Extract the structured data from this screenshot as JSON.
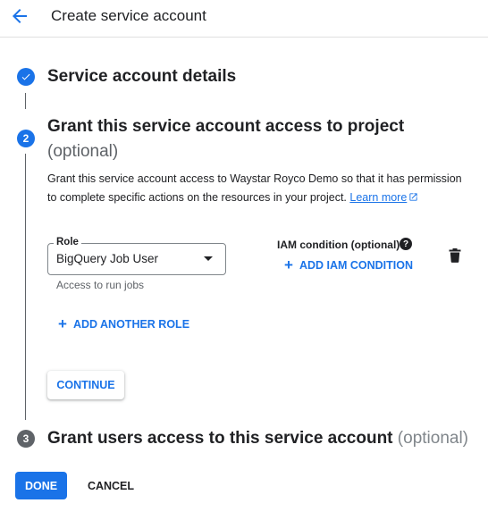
{
  "header": {
    "title": "Create service account"
  },
  "step1": {
    "number": "",
    "title": "Service account details",
    "state": "completed"
  },
  "step2": {
    "number": "2",
    "title": "Grant this service account access to project",
    "optional": "(optional)",
    "description": "Grant this service account access to Waystar Royco Demo so that it has permission to complete specific actions on the resources in your project.",
    "learn_more": "Learn more",
    "role": {
      "label": "Role",
      "value": "BigQuery Job User",
      "hint": "Access to run jobs"
    },
    "iam_condition": {
      "label": "IAM condition (optional)",
      "help": "?",
      "add_label": "ADD IAM CONDITION"
    },
    "add_role_label": "ADD ANOTHER ROLE",
    "continue_label": "CONTINUE"
  },
  "step3": {
    "number": "3",
    "title": "Grant users access to this service account",
    "optional": "(optional)"
  },
  "footer": {
    "done_label": "DONE",
    "cancel_label": "CANCEL"
  },
  "icons": {
    "back": "arrow-back-icon",
    "check": "check-icon",
    "external": "external-link-icon",
    "dropdown": "arrow-drop-down-icon",
    "help": "help-icon",
    "add": "plus-icon",
    "delete": "trash-icon"
  },
  "colors": {
    "accent": "#1a73e8",
    "text": "#202124",
    "muted": "#5f6368",
    "inactive_step": "#5f6368"
  }
}
